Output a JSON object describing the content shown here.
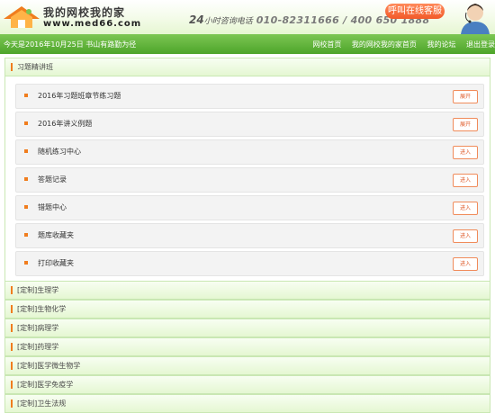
{
  "header": {
    "logo_title": "我的网校我的家",
    "logo_url": "www.med66.com",
    "hotline_num": "24",
    "hotline_label": "小时咨询电话",
    "hotline_phone": "010-82311666 / 400 650 1888",
    "service_button": "呼叫在线客服",
    "colors": {
      "brand_green": "#4da52a",
      "accent_orange": "#f07d1e",
      "service_orange": "#f25a2a"
    }
  },
  "navbar": {
    "date_text": "今天是2016年10月25日  书山有路勤为径",
    "links": [
      "网校首页",
      "我的网校我的家首页",
      "我的论坛",
      "退出登录"
    ]
  },
  "expanded_section": {
    "title": "习题精讲班",
    "items": [
      {
        "label": "2016年习题班章节练习题",
        "action": "展开"
      },
      {
        "label": "2016年讲义例题",
        "action": "展开"
      },
      {
        "label": "随机练习中心",
        "action": "进入"
      },
      {
        "label": "答题记录",
        "action": "进入"
      },
      {
        "label": "错题中心",
        "action": "进入"
      },
      {
        "label": "题库收藏夹",
        "action": "进入"
      },
      {
        "label": "打印收藏夹",
        "action": "进入"
      }
    ]
  },
  "courses": [
    "[定制]生理学",
    "[定制]生物化学",
    "[定制]病理学",
    "[定制]药理学",
    "[定制]医学微生物学",
    "[定制]医学免疫学",
    "[定制]卫生法规"
  ]
}
